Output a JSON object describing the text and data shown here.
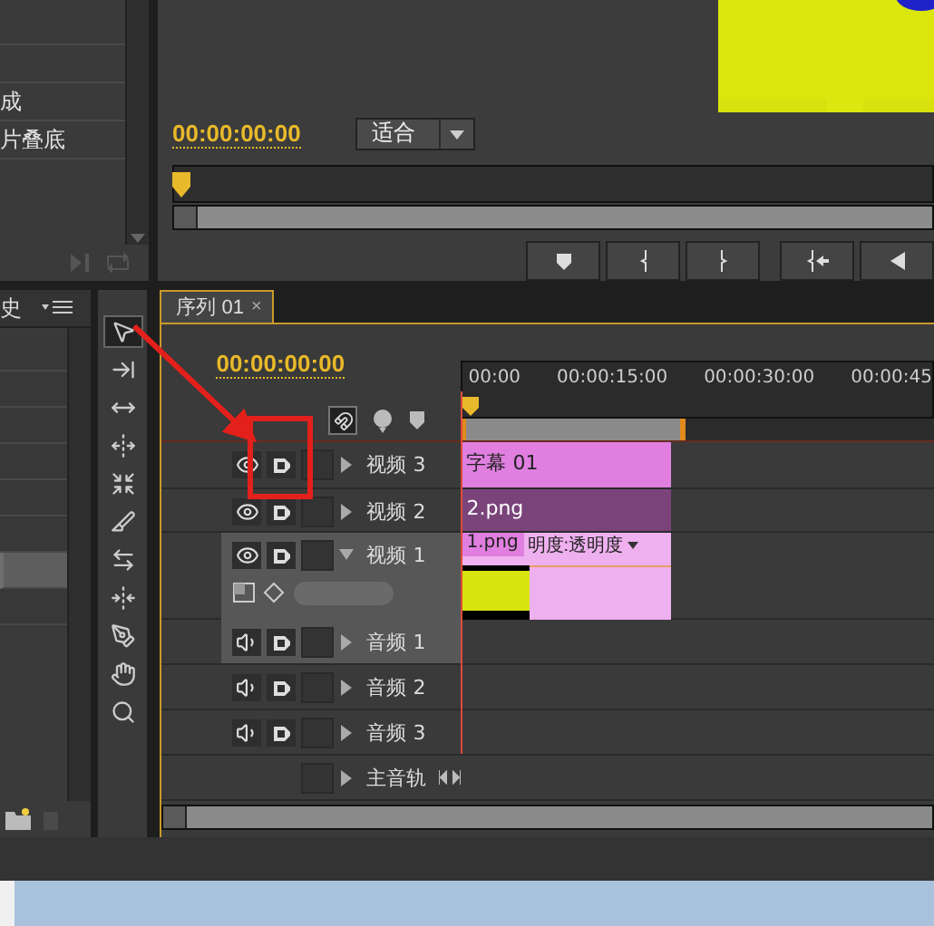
{
  "effects_panel": {
    "rows": [
      "成",
      "片叠底"
    ]
  },
  "program_monitor": {
    "timecode": "00:00:00:00",
    "zoom": "适合",
    "buttons": [
      {
        "kind": "marker"
      },
      {
        "kind": "in"
      },
      {
        "kind": "out"
      },
      {
        "kind": "go_in"
      },
      {
        "kind": "play_back"
      }
    ]
  },
  "history_panel": {
    "tab": "史",
    "rows": [
      {
        "selected": false
      },
      {
        "selected": false
      },
      {
        "selected": false
      },
      {
        "selected": false
      },
      {
        "selected": false
      },
      {
        "selected": false
      },
      {
        "selected": true
      },
      {
        "selected": false
      }
    ]
  },
  "tools": [
    {
      "kind": "select",
      "selected": true
    },
    {
      "kind": "track_select",
      "selected": false
    },
    {
      "kind": "ripple",
      "selected": false
    },
    {
      "kind": "rolling",
      "selected": false
    },
    {
      "kind": "rate",
      "selected": false
    },
    {
      "kind": "razor",
      "selected": false
    },
    {
      "kind": "slip",
      "selected": false
    },
    {
      "kind": "slide",
      "selected": false
    },
    {
      "kind": "pen",
      "selected": false
    },
    {
      "kind": "hand",
      "selected": false
    },
    {
      "kind": "zoom",
      "selected": false
    }
  ],
  "timeline": {
    "tab": "序列 01",
    "close": "×",
    "timecode": "00:00:00:00",
    "ruler": [
      "00:00",
      "00:00:15:00",
      "00:00:30:00",
      "00:00:45"
    ],
    "tracks": [
      {
        "kind": "video",
        "name": "视频 3",
        "selected": false,
        "expanded": false,
        "clip": {
          "label": "字幕 01",
          "color": "#e07fe0"
        }
      },
      {
        "kind": "video",
        "name": "视频 2",
        "selected": false,
        "expanded": false,
        "clip": {
          "label": "2.png",
          "color": "#7a447a"
        }
      },
      {
        "kind": "video",
        "name": "视频 1",
        "selected": true,
        "expanded": true,
        "clip": {
          "label": "1.png",
          "effect": "明度:透明度",
          "color": "#eeb0ee"
        }
      },
      {
        "kind": "audio",
        "name": "音频 1",
        "selected": true,
        "expanded": false
      },
      {
        "kind": "audio",
        "name": "音频 2",
        "selected": false,
        "expanded": false
      },
      {
        "kind": "audio",
        "name": "音频 3",
        "selected": false,
        "expanded": false
      },
      {
        "kind": "master",
        "name": "主音轨",
        "selected": false,
        "expanded": false
      }
    ]
  },
  "callouts": {
    "arrow": true,
    "frame": true
  }
}
